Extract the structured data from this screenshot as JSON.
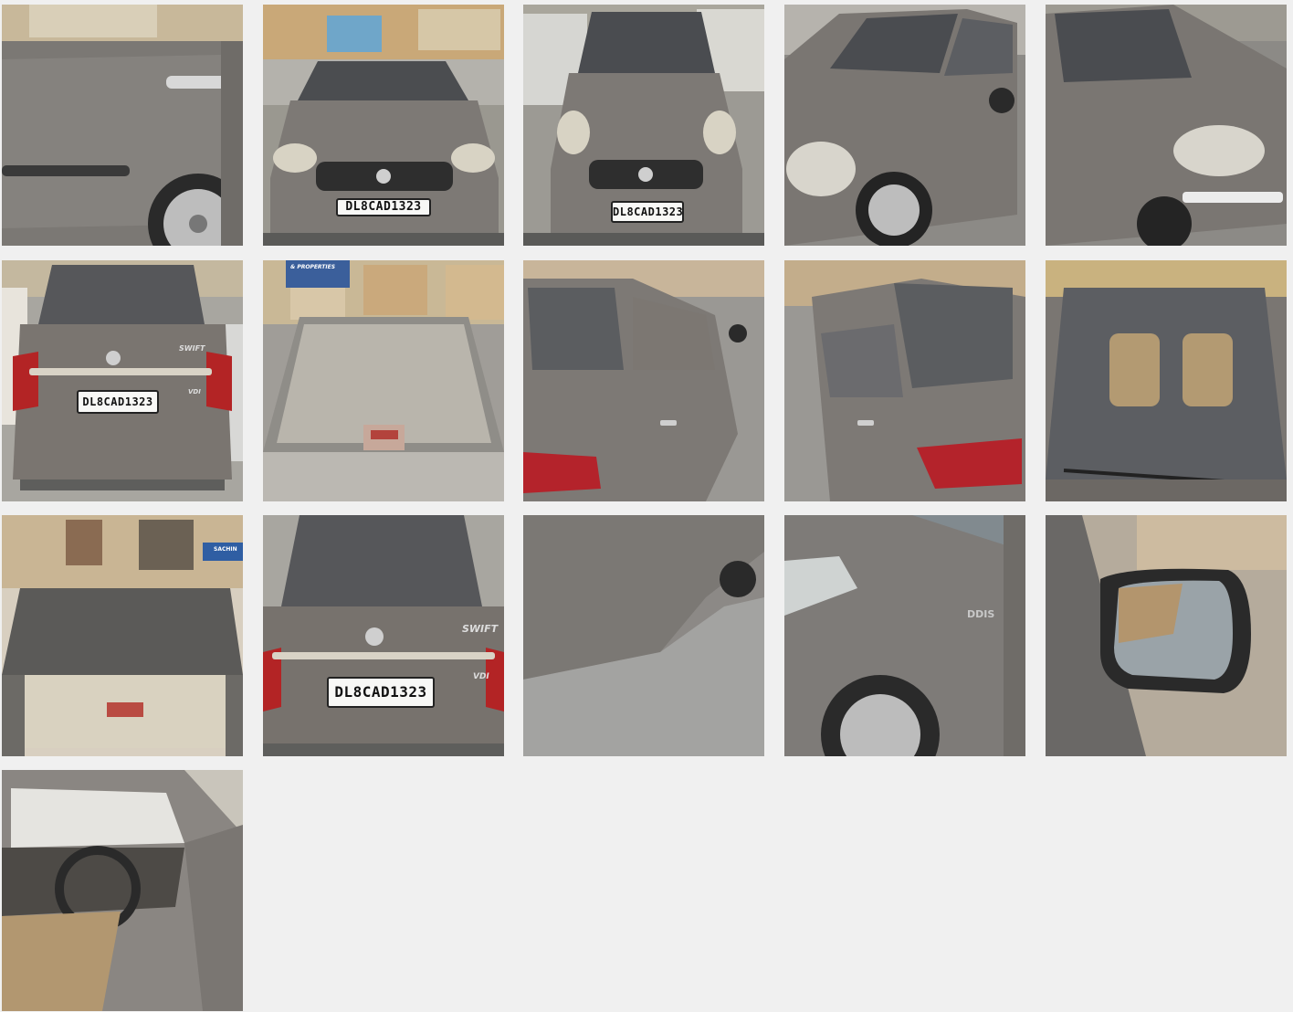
{
  "gallery": {
    "plate_number": "DL8CAD1323",
    "car_color": "#7a7672",
    "background_color": "#f0f0f0",
    "photos": [
      {
        "name": "photo-rear-door-side",
        "view": "door"
      },
      {
        "name": "photo-front",
        "view": "front"
      },
      {
        "name": "photo-front-2",
        "view": "front"
      },
      {
        "name": "photo-front-quarter-left",
        "view": "quarter"
      },
      {
        "name": "photo-front-quarter-right",
        "view": "quarter"
      },
      {
        "name": "photo-rear",
        "view": "rear"
      },
      {
        "name": "photo-rear-windshield",
        "view": "rearglass"
      },
      {
        "name": "photo-rear-quarter-left",
        "view": "rearquarter"
      },
      {
        "name": "photo-rear-quarter-right",
        "view": "rearquarter"
      },
      {
        "name": "photo-windshield",
        "view": "windshield"
      },
      {
        "name": "photo-boot-open",
        "view": "boot"
      },
      {
        "name": "photo-rear-closeup",
        "view": "rear"
      },
      {
        "name": "photo-side-panel",
        "view": "panel"
      },
      {
        "name": "photo-front-fender-ddis",
        "view": "fender"
      },
      {
        "name": "photo-side-mirror",
        "view": "mirror"
      },
      {
        "name": "photo-interior-dashboard",
        "view": "interior"
      }
    ],
    "labels": {
      "ddis": "DDIS",
      "swift": "SWIFT",
      "vdi": "VDI",
      "shop_sign_1": "SACHIN",
      "shop_sign_2": "& PROPERTIES"
    }
  }
}
